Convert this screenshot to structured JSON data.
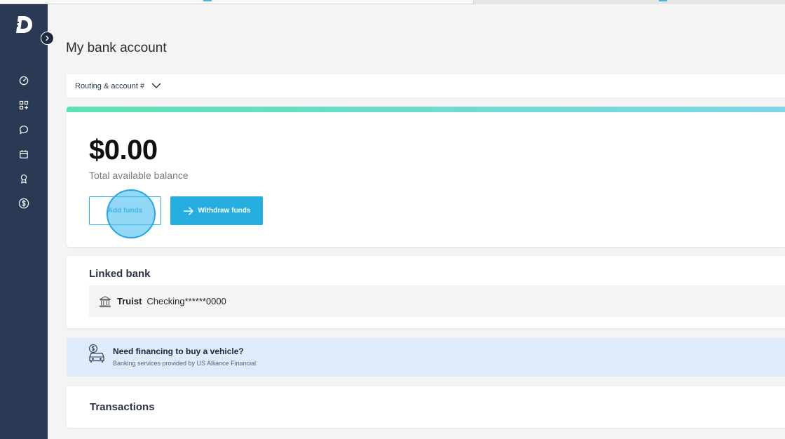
{
  "colors": {
    "sidebar": "#2a3a55",
    "accent": "#27aee0",
    "card_accent_start": "#5fe0b4",
    "card_accent_end": "#7fd6e6",
    "financing_bg": "#deebfa"
  },
  "sidebar": {
    "logo_icon": "d-logo-icon",
    "collapse_icon": "chevron-right-icon",
    "items": [
      {
        "icon": "dashboard-gauge-icon"
      },
      {
        "icon": "apps-grid-icon"
      },
      {
        "icon": "chat-bubble-icon"
      },
      {
        "icon": "calendar-icon"
      },
      {
        "icon": "award-ribbon-icon"
      },
      {
        "icon": "dollar-circle-icon"
      }
    ]
  },
  "page": {
    "title": "My bank account"
  },
  "routing": {
    "label": "Routing & account #",
    "icon": "chevron-down-icon"
  },
  "balance": {
    "amount": "$0.00",
    "label": "Total available balance",
    "add_funds_label": "Add funds",
    "withdraw_label": "Withdraw funds",
    "withdraw_icon": "arrow-right-icon"
  },
  "linked_bank": {
    "title": "Linked bank",
    "bank_icon": "bank-building-icon",
    "bank_name": "Truist",
    "account": "Checking******0000"
  },
  "financing": {
    "icon": "car-finance-icon",
    "title": "Need financing to buy a vehicle?",
    "subtitle": "Banking services provided by US Alliance Financial"
  },
  "transactions": {
    "title": "Transactions"
  }
}
